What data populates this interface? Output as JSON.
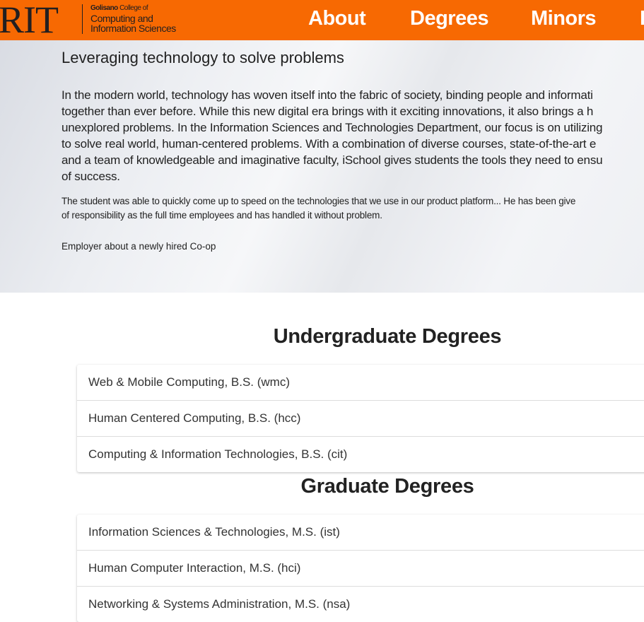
{
  "header": {
    "logo": {
      "wordmark": "RIT",
      "line1_bold": "Golisano",
      "line1_rest": " College of",
      "line2": "Computing and",
      "line3": "Information Sciences"
    },
    "nav": [
      "About",
      "Degrees",
      "Minors",
      "E"
    ]
  },
  "hero": {
    "title": "Leveraging technology to solve problems",
    "intro_lines": [
      "In the modern world, technology has woven itself into the fabric of society, binding people and informati",
      "together than ever before. While this new digital era brings with it exciting innovations, it also brings a h",
      "unexplored problems. In the Information Sciences and Technologies Department, our focus is on utilizing",
      "to solve real world, human-centered problems. With a combination of diverse courses, state-of-the-art e",
      "and a team of knowledgeable and imaginative faculty, iSchool gives students the tools they need to ensu",
      "of success."
    ],
    "quote_lines": [
      "The student was able to quickly come up to speed on the technologies that we use in our product platform... He has been give",
      "of responsibility as the full time employees and has handled it without problem."
    ],
    "attribution": "Employer about a newly hired Co-op"
  },
  "undergraduate": {
    "title": "Undergraduate Degrees",
    "items": [
      "Web & Mobile Computing, B.S. (wmc)",
      "Human Centered Computing, B.S. (hcc)",
      "Computing & Information Technologies, B.S. (cit)"
    ]
  },
  "graduate": {
    "title": "Graduate Degrees",
    "items": [
      "Information Sciences & Technologies, M.S. (ist)",
      "Human Computer Interaction, M.S. (hci)",
      "Networking & Systems Administration, M.S. (nsa)"
    ]
  }
}
